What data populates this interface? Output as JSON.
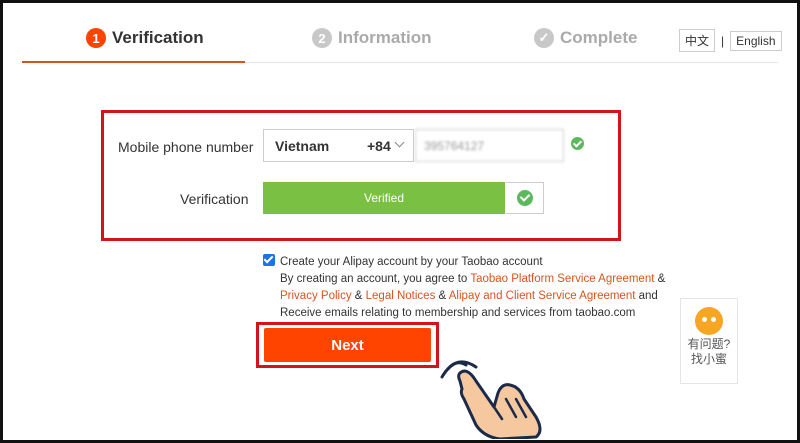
{
  "steps": [
    {
      "num": "1",
      "label": "Verification"
    },
    {
      "num": "2",
      "label": "Information"
    },
    {
      "label": "Complete"
    }
  ],
  "lang": {
    "zh": "中文",
    "sep": "|",
    "en": "English"
  },
  "form": {
    "phone_label": "Mobile phone number",
    "country": "Vietnam",
    "country_code": "+84",
    "phone_value": "395764127",
    "verification_label": "Verification",
    "verified_text": "Verified"
  },
  "agreement": {
    "line1": "Create your Alipay account by your Taobao account",
    "line2_prefix": "By creating an account, you agree to ",
    "link1": "Taobao Platform Service Agreement",
    "amp": " &",
    "link2": "Privacy Policy",
    "amp2": " & ",
    "link3": "Legal Notices",
    "amp3": " & ",
    "link4": "Alipay and Client Service Agreement",
    "and_text": " and",
    "line_last": "Receive emails relating to membership and services from taobao.com"
  },
  "next_label": "Next",
  "help": {
    "line1": "有问题?",
    "line2": "找小蜜"
  },
  "colors": {
    "accent": "#ff4400",
    "verified": "#7ac143",
    "highlight": "#d4141c"
  }
}
